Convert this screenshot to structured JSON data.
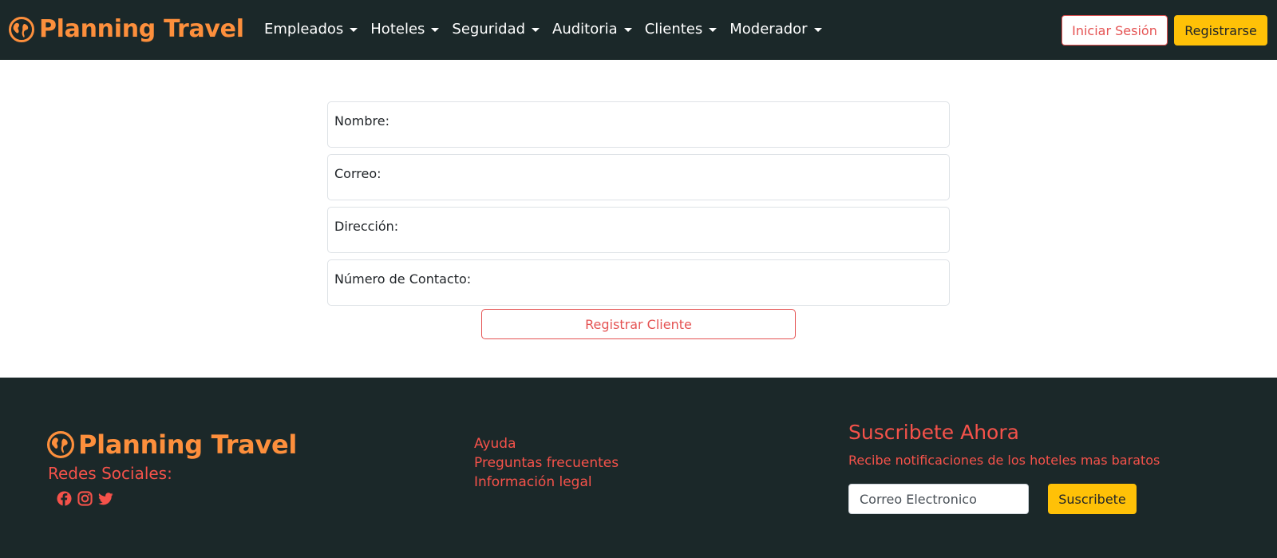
{
  "navbar": {
    "brand": "Planning Travel",
    "menu": [
      {
        "label": "Empleados"
      },
      {
        "label": "Hoteles"
      },
      {
        "label": "Seguridad"
      },
      {
        "label": "Auditoria"
      },
      {
        "label": "Clientes"
      },
      {
        "label": "Moderador"
      }
    ],
    "login_label": "Iniciar Sesión",
    "register_label": "Registrarse"
  },
  "form": {
    "fields": [
      {
        "label": "Nombre:"
      },
      {
        "label": "Correo:"
      },
      {
        "label": "Dirección:"
      },
      {
        "label": "Número de Contacto:"
      }
    ],
    "submit_label": "Registrar Cliente"
  },
  "footer": {
    "brand": "Planning Travel",
    "social_title": "Redes Sociales:",
    "social_icons": [
      "facebook-icon",
      "instagram-icon",
      "twitter-icon"
    ],
    "links": [
      {
        "label": "Ayuda"
      },
      {
        "label": "Preguntas frecuentes"
      },
      {
        "label": "Información legal"
      }
    ],
    "subscribe_title": "Suscribete Ahora",
    "subscribe_text": "Recibe notificaciones de los hoteles mas baratos",
    "email_placeholder": "Correo Electronico",
    "subscribe_button": "Suscribete"
  },
  "colors": {
    "dark_bg": "#1b2829",
    "brand_orange": "#fd8f3c",
    "accent_red": "#e55353",
    "button_yellow": "#ffc107"
  }
}
